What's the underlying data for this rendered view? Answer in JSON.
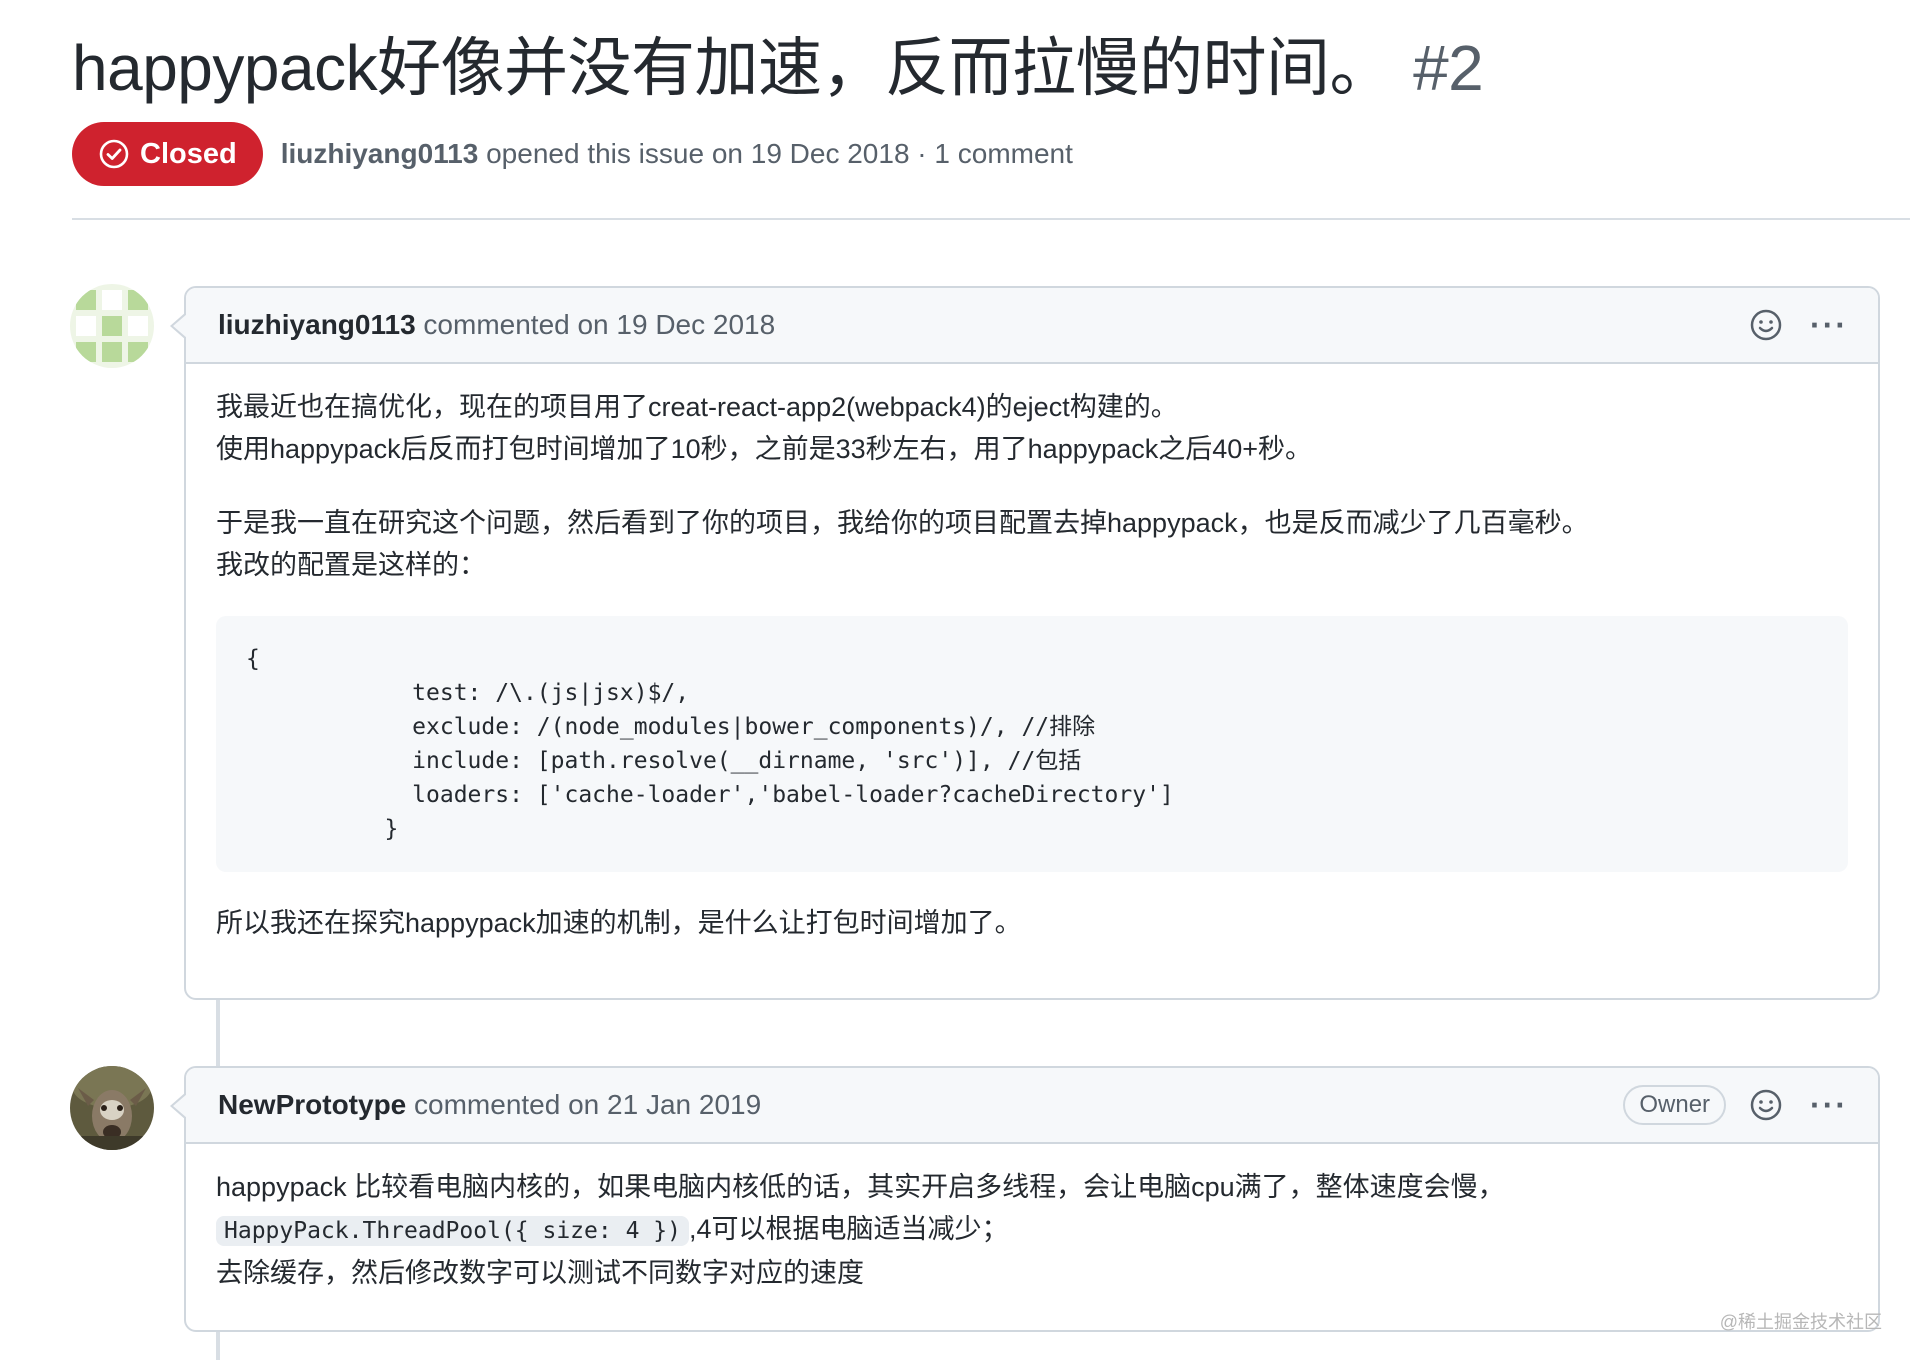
{
  "issue": {
    "title": "happypack好像并没有加速，反而拉慢的时间。",
    "number": "#2",
    "state": "Closed",
    "state_color": "#cf222e",
    "author": "liuzhiyang0113",
    "meta_suffix": " opened this issue on 19 Dec 2018 · 1 comment"
  },
  "comments": [
    {
      "author": "liuzhiyang0113",
      "action": " commented on 19 Dec 2018",
      "avatar_icon": "identicon-avatar",
      "body": {
        "line1": "我最近也在搞优化，现在的项目用了creat-react-app2(webpack4)的eject构建的。",
        "line2": "使用happypack后反而打包时间增加了10秒，之前是33秒左右，用了happypack之后40+秒。",
        "line3": "于是我一直在研究这个问题，然后看到了你的项目，我给你的项目配置去掉happypack，也是反而减少了几百毫秒。",
        "line4": "我改的配置是这样的：",
        "code": "{\n            test: /\\.(js|jsx)$/,\n            exclude: /(node_modules|bower_components)/, //排除\n            include: [path.resolve(__dirname, 'src')], //包括\n            loaders: ['cache-loader','babel-loader?cacheDirectory']\n          }",
        "line5": "所以我还在探究happypack加速的机制，是什么让打包时间增加了。"
      }
    },
    {
      "author": "NewPrototype",
      "action": " commented on 21 Jan 2019",
      "badge": "Owner",
      "avatar_icon": "user-photo-avatar",
      "body": {
        "line1": "happypack 比较看电脑内核的，如果电脑内核低的话，其实开启多线程，会让电脑cpu满了，整体速度会慢，",
        "code_inline": "HappyPack.ThreadPool({ size: 4 })",
        "line2_suffix": ",4可以根据电脑适当减少；",
        "line3": "去除缓存，然后修改数字可以测试不同数字对应的速度"
      }
    }
  ],
  "watermark": "@稀土掘金技术社区"
}
